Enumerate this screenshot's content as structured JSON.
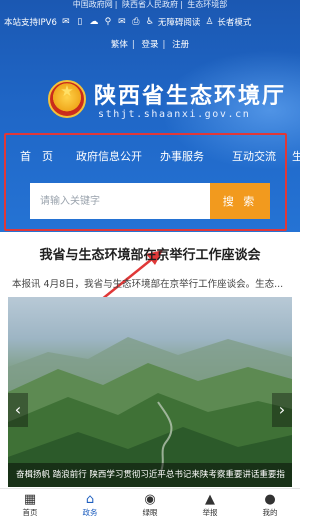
{
  "top_links": [
    "中国政府网",
    "陕西省人民政府",
    "生态环境部"
  ],
  "toolbar": {
    "ipv6_label": "本站支持IPV6",
    "accessibility_label": "无障碍阅读",
    "elder_label": "长者模式"
  },
  "lang_links": [
    "繁体",
    "登录",
    "注册"
  ],
  "brand": {
    "title": "陕西省生态环境厅",
    "domain": "sthjt.shaanxi.gov.cn"
  },
  "nav": [
    "首　页",
    "政府信息公开",
    "办事服务",
    "互动交流",
    "生"
  ],
  "search": {
    "placeholder": "请输入关键字",
    "button_label": "搜 索"
  },
  "news": {
    "headline": "我省与生态环境部在京举行工作座谈会",
    "summary": "本报讯 4月8日，我省与生态环境部在京举行工作座谈会。生态...",
    "photo_caption": "奋楫扬帆 踏浪前行 陕西学习贯彻习近平总书记来陕考察重要讲话重要指"
  },
  "tabbar": [
    {
      "label": "首页",
      "icon": "home-icon"
    },
    {
      "label": "政务",
      "icon": "government-icon"
    },
    {
      "label": "绿眼",
      "icon": "green-eye-icon"
    },
    {
      "label": "举报",
      "icon": "report-icon"
    },
    {
      "label": "我的",
      "icon": "profile-icon"
    }
  ],
  "colors": {
    "primary_blue": "#1f66c6",
    "search_button": "#f29a1e",
    "annotation_red": "#e03838",
    "active_tab": "#1f5fbf"
  }
}
